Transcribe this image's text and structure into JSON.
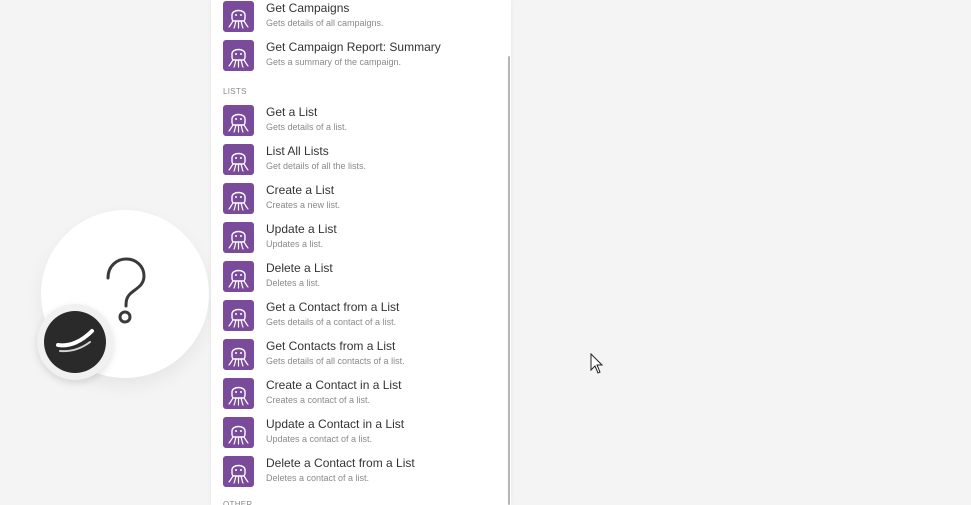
{
  "canvas": {
    "module_icon": "question-mark-icon",
    "app_icon": "app-logo-icon",
    "cursor_icon": "mouse-pointer-icon"
  },
  "colors": {
    "app_brand": "#7a4a9b",
    "background": "#f4f4f4",
    "panel": "#ffffff"
  },
  "menu": {
    "section_lists": "LISTS",
    "section_other": "OTHER",
    "campaign_items": [
      {
        "title": "Get Campaigns",
        "desc": "Gets details of all campaigns."
      },
      {
        "title": "Get Campaign Report: Summary",
        "desc": "Gets a summary of the campaign."
      }
    ],
    "list_items": [
      {
        "title": "Get a List",
        "desc": "Gets details of a list."
      },
      {
        "title": "List All Lists",
        "desc": "Get details of all the lists."
      },
      {
        "title": "Create a List",
        "desc": "Creates a new list."
      },
      {
        "title": "Update a List",
        "desc": "Updates a list."
      },
      {
        "title": "Delete a List",
        "desc": "Deletes a list."
      },
      {
        "title": "Get a Contact from a List",
        "desc": "Gets details of a contact of a list."
      },
      {
        "title": "Get Contacts from a List",
        "desc": "Gets details of all contacts of a list."
      },
      {
        "title": "Create a Contact in a List",
        "desc": "Creates a contact of a list."
      },
      {
        "title": "Update a Contact in a List",
        "desc": "Updates a contact of a list."
      },
      {
        "title": "Delete a Contact from a List",
        "desc": "Deletes a contact of a list."
      }
    ]
  }
}
